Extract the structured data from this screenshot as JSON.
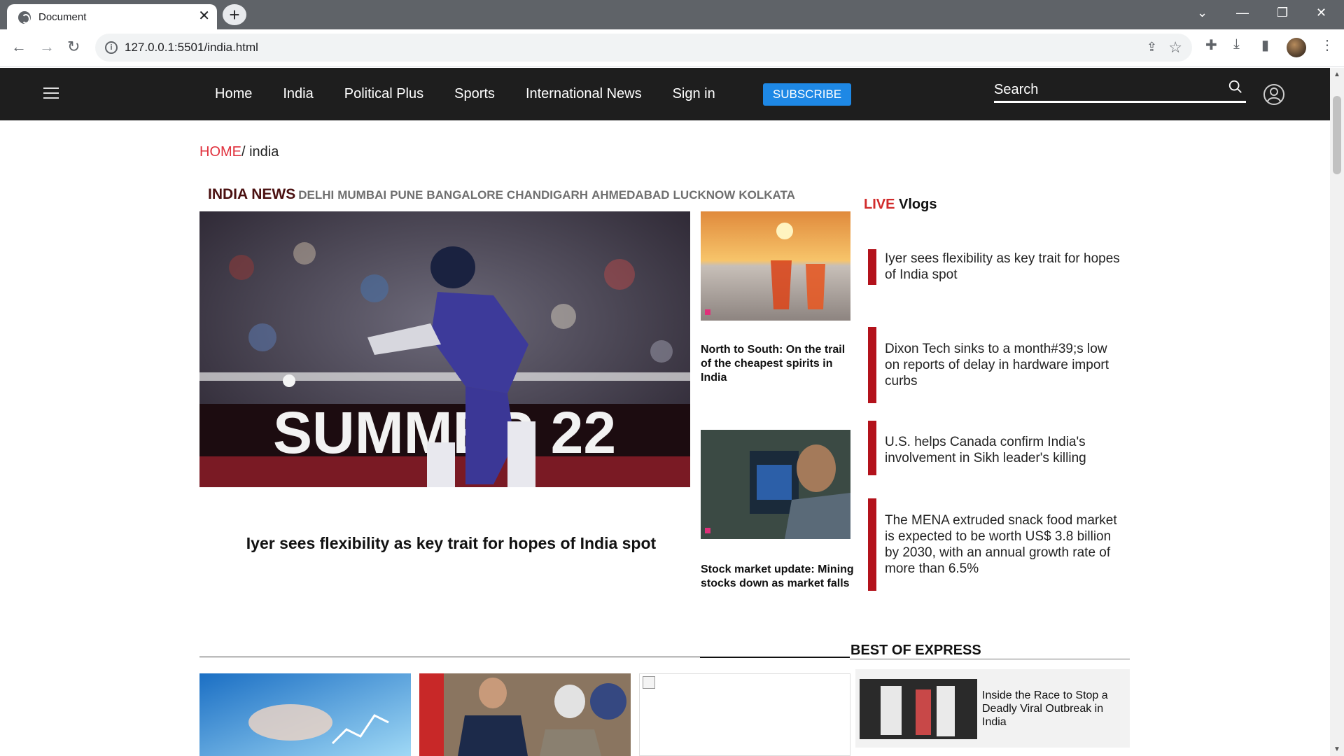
{
  "browser": {
    "tab_title": "Document",
    "url": "127.0.0.1:5501/india.html"
  },
  "header": {
    "nav": [
      "Home",
      "India",
      "Political Plus",
      "Sports",
      "International News",
      "Sign in"
    ],
    "subscribe": "SUBSCRIBE",
    "search_label": "Search"
  },
  "breadcrumb": {
    "home": "HOME",
    "current": "/ india"
  },
  "india_news": {
    "title": "INDIA NEWS",
    "cities": [
      "DELHI",
      "MUMBAI",
      "PUNE",
      "BANGALORE",
      "CHANDIGARH",
      "AHMEDABAD",
      "LUCKNOW",
      "KOLKATA"
    ]
  },
  "hero": {
    "image_text": "SUMMER 22",
    "caption": "Iyer sees flexibility as key trait for hopes of India spot"
  },
  "side_cards": [
    {
      "title": "North to South: On the trail of the cheapest spirits in India"
    },
    {
      "title": "Stock market update: Mining stocks down as market falls"
    }
  ],
  "live": {
    "label_red": "LIVE",
    "label": " Vlogs",
    "items": [
      "Iyer sees flexibility as key trait for hopes of India spot",
      "Dixon Tech sinks to a month#39;s low on reports of delay in hardware import curbs",
      "U.S. helps Canada confirm India's involvement in Sikh leader's killing",
      "The MENA extruded snack food market is expected to be worth US$ 3.8 billion by 2030, with an annual growth rate of more than 6.5%"
    ]
  },
  "best_of_express": {
    "title": "BEST OF EXPRESS",
    "card_title": "Inside the Race to Stop a Deadly Viral Outbreak in India"
  }
}
